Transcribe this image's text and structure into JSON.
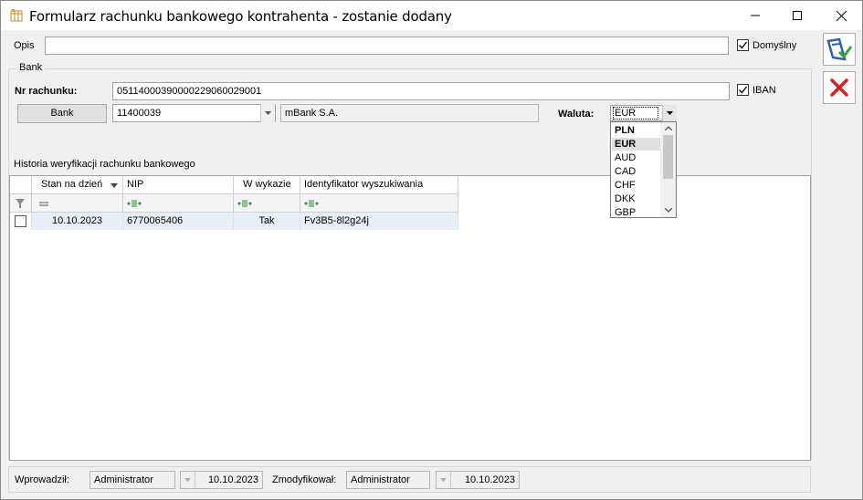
{
  "window": {
    "title": "Formularz rachunku bankowego kontrahenta - zostanie dodany"
  },
  "opis": {
    "label": "Opis",
    "value": "",
    "domyslny_label": "Domyślny",
    "domyslny_checked": true
  },
  "bank_group": {
    "legend": "Bank",
    "nr_rachunku_label": "Nr rachunku:",
    "nr_rachunku_value": "05114000390000229060029001",
    "iban_label": "IBAN",
    "iban_checked": true,
    "bank_button": "Bank",
    "bank_code": "11400039",
    "bank_name": "mBank S.A.",
    "waluta_label": "Waluta:",
    "waluta_value": "EUR",
    "waluta_options": [
      "PLN",
      "EUR",
      "AUD",
      "CAD",
      "CHF",
      "DKK",
      "GBP"
    ],
    "waluta_highlighted": "EUR"
  },
  "history": {
    "title": "Historia weryfikacji rachunku bankowego",
    "columns": [
      "Stan na dzień",
      "NIP",
      "W wykazie",
      "Identyfikator wyszukiwania"
    ],
    "rows": [
      {
        "date": "10.10.2023",
        "nip": "6770065406",
        "w_wykazie": "Tak",
        "id": "Fv3B5-8l2g24j"
      }
    ]
  },
  "footer": {
    "wprowadzil_label": "Wprowadził:",
    "wprowadzil_user": "Administrator",
    "wprowadzil_date": "10.10.2023",
    "zmodyfikowal_label": "Zmodyfikował:",
    "zmodyfikowal_user": "Administrator",
    "zmodyfikowal_date": "10.10.2023"
  },
  "colors": {
    "save_accent": "#2a62b8",
    "cancel_accent": "#d42020",
    "row_selected": "#e8eef9"
  }
}
